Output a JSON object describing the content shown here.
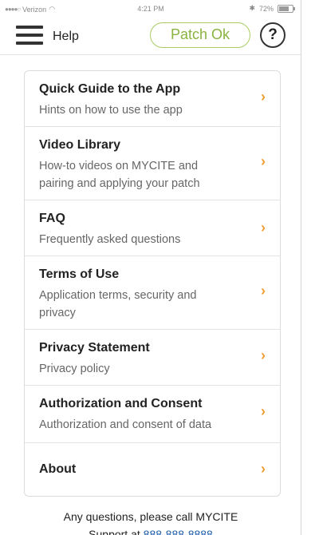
{
  "status_bar": {
    "signal": "●●●●○",
    "carrier": "Verizon",
    "wifi_icon": "wifi-icon",
    "time": "4:21 PM",
    "bluetooth": "✱",
    "battery_percent": "72%"
  },
  "header": {
    "title": "Help",
    "patch_button_label": "Patch Ok",
    "help_label": "?",
    "patch_color": "#8ab33f"
  },
  "menu": {
    "items": [
      {
        "title": "Quick Guide to the App",
        "subtitle": "Hints on how to use the app"
      },
      {
        "title": "Video Library",
        "subtitle": "How-to videos on MYCITE and pairing and applying your patch"
      },
      {
        "title": "FAQ",
        "subtitle": "Frequently asked questions"
      },
      {
        "title": "Terms of Use",
        "subtitle": "Application terms, security and privacy"
      },
      {
        "title": "Privacy Statement",
        "subtitle": "Privacy policy"
      },
      {
        "title": "Authorization and Consent",
        "subtitle": "Authorization and consent of data"
      },
      {
        "title": "About",
        "subtitle": ""
      }
    ],
    "chevron": "›",
    "chevron_color": "#f0a033"
  },
  "footer": {
    "line1": "Any questions, please call MYCITE",
    "line2_prefix": "Support at ",
    "phone": "888-888-8888"
  }
}
